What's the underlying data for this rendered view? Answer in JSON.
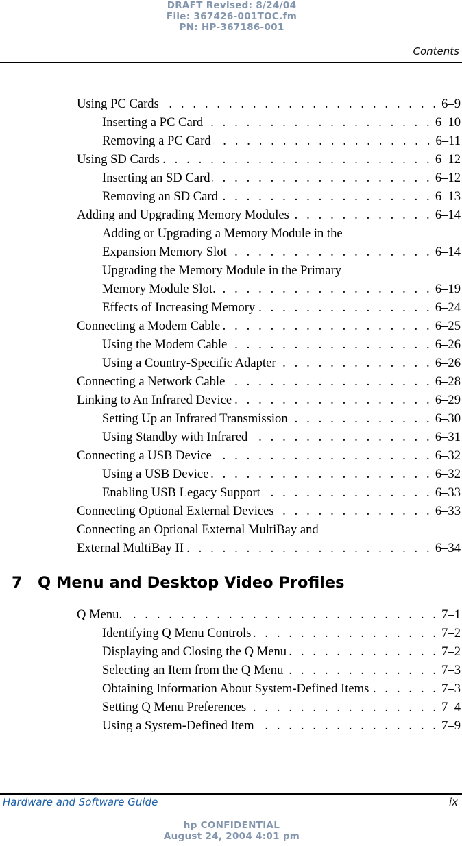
{
  "header": {
    "draft_lines": [
      "DRAFT Revised: 8/24/04",
      "File: 367426-001TOC.fm",
      "PN: HP-367186-001"
    ],
    "running_head": "Contents"
  },
  "toc": {
    "chapter6_entries": [
      {
        "level": 1,
        "title": "Using PC Cards",
        "page": "6–9"
      },
      {
        "level": 2,
        "title": "Inserting a PC Card",
        "page": "6–10"
      },
      {
        "level": 2,
        "title": "Removing a PC Card",
        "page": "6–11"
      },
      {
        "level": 1,
        "title": "Using SD Cards",
        "page": "6–12"
      },
      {
        "level": 2,
        "title": "Inserting an SD Card",
        "page": "6–12"
      },
      {
        "level": 2,
        "title": "Removing an SD Card",
        "page": "6–13"
      },
      {
        "level": 1,
        "title": "Adding and Upgrading Memory Modules",
        "page": "6–14"
      },
      {
        "level": 2,
        "title": "Adding or Upgrading a Memory Module in the",
        "page": ""
      },
      {
        "level": 2,
        "title": "Expansion Memory Slot",
        "page": "6–14"
      },
      {
        "level": 2,
        "title": "Upgrading the Memory Module in the Primary",
        "page": ""
      },
      {
        "level": 2,
        "title": "Memory Module Slot.",
        "page": "6–19"
      },
      {
        "level": 2,
        "title": "Effects of Increasing Memory",
        "page": "6–24"
      },
      {
        "level": 1,
        "title": "Connecting a Modem Cable",
        "page": "6–25"
      },
      {
        "level": 2,
        "title": "Using the Modem Cable",
        "page": "6–26"
      },
      {
        "level": 2,
        "title": "Using a Country-Specific Adapter",
        "page": "6–26"
      },
      {
        "level": 1,
        "title": "Connecting a Network Cable",
        "page": "6–28"
      },
      {
        "level": 1,
        "title": "Linking to An Infrared Device",
        "page": "6–29"
      },
      {
        "level": 2,
        "title": "Setting Up an Infrared Transmission",
        "page": "6–30"
      },
      {
        "level": 2,
        "title": "Using Standby with Infrared",
        "page": "6–31"
      },
      {
        "level": 1,
        "title": "Connecting a USB Device",
        "page": "6–32"
      },
      {
        "level": 2,
        "title": "Using a USB Device",
        "page": "6–32"
      },
      {
        "level": 2,
        "title": "Enabling USB Legacy Support",
        "page": "6–33"
      },
      {
        "level": 1,
        "title": "Connecting Optional External Devices",
        "page": "6–33"
      },
      {
        "level": 1,
        "title": "Connecting an Optional External MultiBay and",
        "page": ""
      },
      {
        "level": 1,
        "title": "External MultiBay II",
        "page": "6–34"
      }
    ],
    "chapter7": {
      "number": "7",
      "title": "Q Menu and Desktop Video Profiles",
      "entries": [
        {
          "level": 1,
          "title": "Q Menu.",
          "page": "7–1"
        },
        {
          "level": 2,
          "title": "Identifying Q Menu Controls",
          "page": "7–2"
        },
        {
          "level": 2,
          "title": "Displaying and Closing the Q Menu",
          "page": "7–2"
        },
        {
          "level": 2,
          "title": "Selecting an Item from the Q Menu",
          "page": "7–3"
        },
        {
          "level": 2,
          "title": "Obtaining Information About System-Defined Items",
          "page": "7–3"
        },
        {
          "level": 2,
          "title": "Setting Q Menu Preferences",
          "page": "7–4"
        },
        {
          "level": 2,
          "title": "Using a System-Defined Item",
          "page": "7–9"
        }
      ]
    },
    "leader_dots": ". . . . . . . . . . . . . . . . . . . . . . . . . . . . . . . . . . . . . . . . . . . . . . . . . . . ."
  },
  "footer": {
    "guide_title": "Hardware and Software Guide",
    "page_number": "ix",
    "confidential_lines": [
      "hp CONFIDENTIAL",
      "August 24, 2004 4:01 pm"
    ]
  }
}
